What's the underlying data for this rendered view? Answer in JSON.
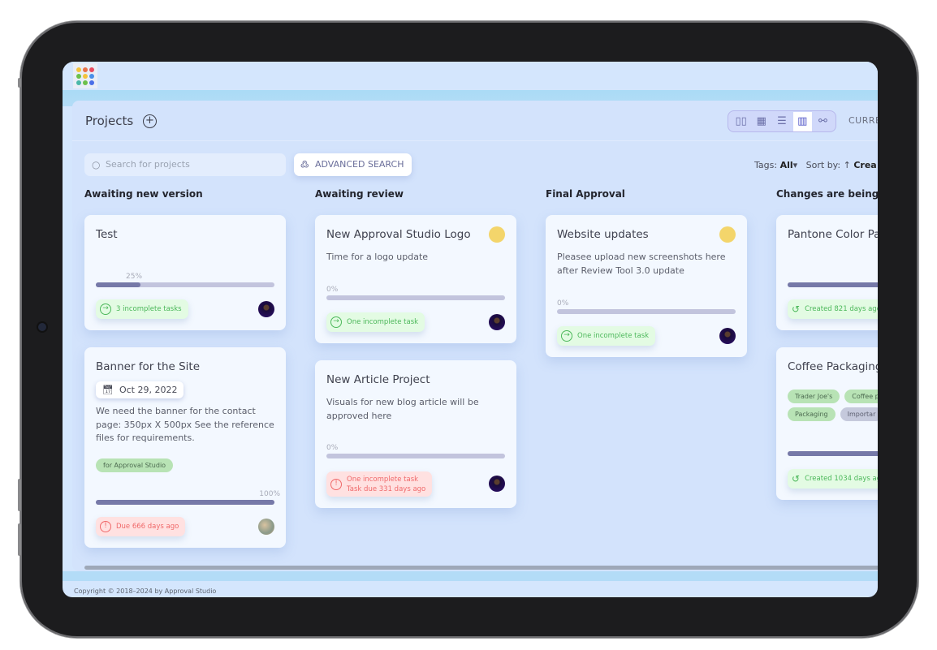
{
  "header": {
    "title": "Projects",
    "add_icon": "plus-circle-icon",
    "current_label": "CURRE"
  },
  "view_switcher": {
    "icons": [
      "columns-view-icon",
      "grid-view-icon",
      "list-view-icon",
      "kanban-view-icon",
      "workflow-view-icon"
    ],
    "active": "kanban-view-icon"
  },
  "search": {
    "placeholder": "Search for projects",
    "advanced_label": "ADVANCED SEARCH"
  },
  "filters": {
    "tags_label": "Tags:",
    "tags_value": "All",
    "sort_label": "Sort by:",
    "sort_value": "Crea"
  },
  "columns": [
    {
      "title": "Awaiting new version"
    },
    {
      "title": "Awaiting review"
    },
    {
      "title": "Final Approval"
    },
    {
      "title": "Changes are being a"
    }
  ],
  "cards": {
    "test": {
      "title": "Test",
      "progress": 25,
      "progress_label": "25%",
      "badge": "3 incomplete tasks"
    },
    "banner": {
      "title": "Banner for the Site",
      "date": "Oct 29, 2022",
      "desc": "We need the banner for the contact page: 350px X 500px See the reference files for requirements.",
      "tag": "for Approval Studio",
      "progress": 100,
      "progress_label": "100%",
      "badge": "Due 666 days ago"
    },
    "logo": {
      "title": "New Approval Studio Logo",
      "desc": "Time for a logo update",
      "progress": 0,
      "progress_label": "0%",
      "badge": "One incomplete task"
    },
    "article": {
      "title": "New Article Project",
      "desc": "Visuals for new blog article will be approved here",
      "progress": 0,
      "progress_label": "0%",
      "badge_line1": "One incomplete task",
      "badge_line2": "Task due 331 days ago"
    },
    "website": {
      "title": "Website updates",
      "desc": "Pleasee upload new screenshots here after Review Tool 3.0 update",
      "progress": 0,
      "progress_label": "0%",
      "badge": "One incomplete task"
    },
    "pantone": {
      "title": "Pantone Color Pa",
      "badge": "Created 821 days ago"
    },
    "coffee": {
      "title": "Coffee Packaging",
      "tags": [
        "Trader Joe's",
        "Coffee p",
        "Packaging",
        "Importar"
      ],
      "badge": "Created 1034 days ag"
    }
  },
  "footer": {
    "copyright": "Copyright © 2018–2024 by Approval Studio"
  },
  "colors": {
    "accent": "#5155c8",
    "status_dot": "#f3d56b",
    "success": "#4cb85a",
    "danger": "#f0696a"
  }
}
